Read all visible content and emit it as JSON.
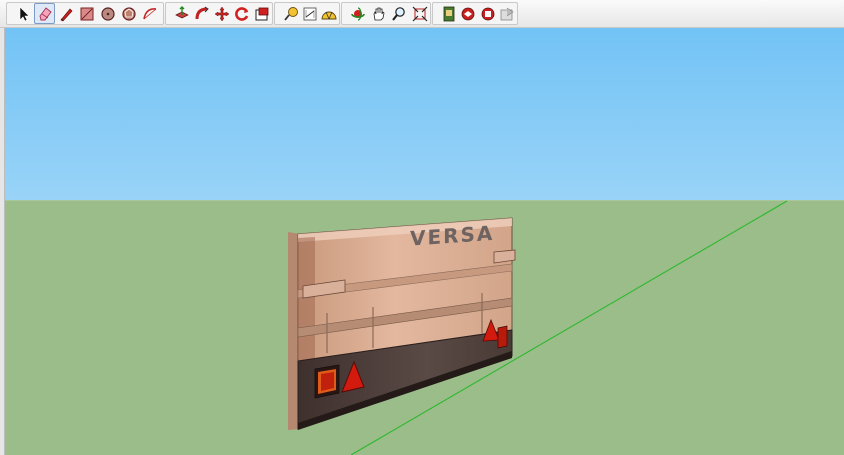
{
  "app": {
    "toolbar": {
      "groups": [
        {
          "name": "principal",
          "tools": [
            {
              "id": "select",
              "icon": "arrow-select-icon"
            },
            {
              "id": "eraser",
              "icon": "eraser-icon",
              "active": true
            },
            {
              "id": "line",
              "icon": "pencil-line-icon"
            },
            {
              "id": "rectangle",
              "icon": "rectangle-icon"
            },
            {
              "id": "circle",
              "icon": "circle-icon"
            },
            {
              "id": "polygon",
              "icon": "polygon-icon"
            },
            {
              "id": "arc",
              "icon": "arc-icon"
            }
          ]
        },
        {
          "name": "edit",
          "tools": [
            {
              "id": "push-pull",
              "icon": "push-pull-icon"
            },
            {
              "id": "follow-me",
              "icon": "follow-me-icon"
            },
            {
              "id": "move",
              "icon": "move-icon"
            },
            {
              "id": "rotate",
              "icon": "rotate-icon"
            },
            {
              "id": "offset",
              "icon": "offset-icon"
            }
          ]
        },
        {
          "name": "construction",
          "tools": [
            {
              "id": "tape-measure",
              "icon": "tape-measure-icon"
            },
            {
              "id": "dimension",
              "icon": "dimension-icon"
            },
            {
              "id": "protractor",
              "icon": "protractor-icon"
            }
          ]
        },
        {
          "name": "camera",
          "tools": [
            {
              "id": "orbit",
              "icon": "orbit-icon"
            },
            {
              "id": "pan",
              "icon": "pan-hand-icon"
            },
            {
              "id": "zoom",
              "icon": "zoom-icon"
            },
            {
              "id": "zoom-extents",
              "icon": "zoom-extents-icon"
            }
          ]
        },
        {
          "name": "warehouse",
          "tools": [
            {
              "id": "get-models",
              "icon": "3d-warehouse-icon"
            },
            {
              "id": "share-model",
              "icon": "share-model-icon"
            },
            {
              "id": "share-component",
              "icon": "share-component-icon"
            },
            {
              "id": "extension-warehouse",
              "icon": "extension-warehouse-icon"
            }
          ]
        }
      ]
    },
    "model": {
      "panel_brand_text": "VERSA",
      "colors": {
        "sky_top": "#72c3f6",
        "sky_bottom": "#e3f2fb",
        "ground": "#9abd8a",
        "axis_green": "#2eb82e",
        "panel_cream": "#e2b59c",
        "panel_dark": "#4a3c39",
        "reflector_red": "#cc1a10"
      }
    }
  }
}
